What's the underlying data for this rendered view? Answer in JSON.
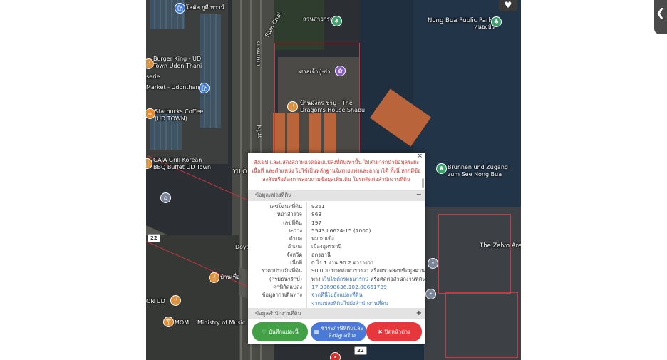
{
  "map": {
    "labels": {
      "lotus": "โลตัส ยูดี ทาวน์",
      "sam_chai": "Sam Chai",
      "park_thai": "สวนสาธารณะ",
      "nong_bua_park": "Nong Bua Public Park",
      "nong_bua_thai": "หนองบัว",
      "burger_king": "Burger King - UD\nTown Udon Thani",
      "market": "Market - Udonthani",
      "shrine": "ศาลเจ้าปู่-ย่า",
      "dragon_house": "บ้านมังกร ชาบู - The\nDragon's House Shabu",
      "starbucks": "Starbucks Coffee\n(UD TOWN)",
      "gaja": "GAJA Grill Korean\nBBQ Buffet UD Town",
      "yu": "YU O",
      "brunnen": "Brunnen und Zugang\nzum See Nong Bua",
      "doya": "Doya",
      "zalvo": "The Zalvo Are",
      "baan": "บ้านเพื่อ",
      "on_ud": "ON UD",
      "mom": "MOM",
      "ministry": "Ministry of Music",
      "road_thai": "ถนนทหาร",
      "station": "รถไฟ",
      "serie": "serie"
    },
    "shields": {
      "left": "22",
      "bottom": "22"
    },
    "colors": {
      "parcel": "#d0343c"
    }
  },
  "ui": {
    "favorite_icon": "heart-icon",
    "side_handle_glyph": "❮"
  },
  "modal": {
    "close": "×",
    "warning": "สังเขป และแสดงสภาพแวดล้อมแปลงที่ดินเท่านั้น ไม่สามารถนำข้อมูลระยะ เนื้อที่ และตำแหน่ง ไปใช้เป็นหลักฐานในทางแพ่งและอาญาได้ ทั้งนี้ หากมีข้อสงสัยหรือต้องการสอบถามข้อมูลเพิ่มเติม โปรดติดต่อสำนักงานที่ดิน",
    "section1": {
      "title": "ข้อมูลแปลงที่ดิน",
      "toggle": "−"
    },
    "rows": [
      {
        "label": "เลขโฉนดที่ดิน",
        "value": "9261"
      },
      {
        "label": "หน้าสำรวจ",
        "value": "863"
      },
      {
        "label": "เลขที่ดิน",
        "value": "197"
      },
      {
        "label": "ระวาง",
        "value": "5543 I 6624-15 (1000)"
      },
      {
        "label": "ตำบล",
        "value": "หมากแข้ง"
      },
      {
        "label": "อำเภอ",
        "value": "เมืองอุดรธานี"
      },
      {
        "label": "จังหวัด",
        "value": "อุดรธานี"
      },
      {
        "label": "เนื้อที่",
        "value": "0 ไร่ 1 งาน 90.2 ตารางวา"
      },
      {
        "label": "ราคาประเมินที่ดิน",
        "value": "90,000 บาทต่อตารางวา หรือตรวจสอบข้อมูลผ่าน"
      },
      {
        "label": "(กรมธนารักษ์)",
        "value_prefix": "ทาง ",
        "value_link": "เว็บไซต์กรมธนารักษ์",
        "value_suffix": " หรือติดต่อสำนักงานที่ดิน"
      },
      {
        "label": "ค่าพิกัดแปลง",
        "value_link": "17.39698636,102.80661739"
      },
      {
        "label": "ข้อมูลการเดินทาง",
        "value_link": "จากที่นี่ไปยังแปลงที่ดิน"
      },
      {
        "label": "",
        "value_link": "จากแปลงที่ดินไปยังสำนักงานที่ดิน"
      }
    ],
    "section2": {
      "title": "ข้อมูลสำนักงานที่ดิน",
      "toggle": "+"
    },
    "buttons": {
      "save": "บันทึกแปลงนี้",
      "fee_line1": "ชำระภาษีที่ดินและ",
      "fee_line2": "สิ่งปลูกสร้าง",
      "close": "ปิดหน้าต่าง"
    },
    "colors": {
      "warning": "#d6322b",
      "link": "#3a79c9",
      "save_button": "#43a047",
      "fee_button": "#4a79d8",
      "close_button": "#e5373c"
    }
  }
}
